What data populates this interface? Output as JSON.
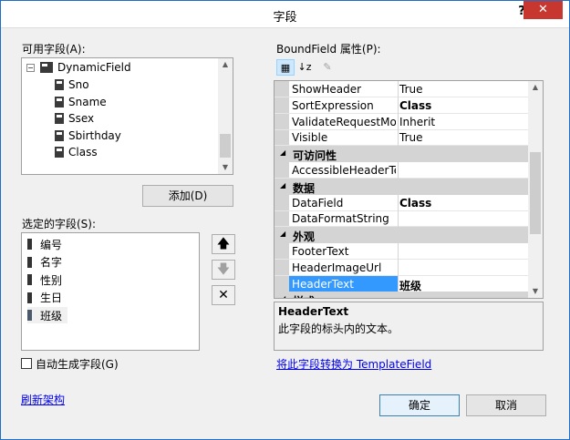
{
  "dialog": {
    "title": "字段",
    "help": "?",
    "close": "✕"
  },
  "available": {
    "label": "可用字段(A):",
    "root": "DynamicField",
    "fields": [
      "Sno",
      "Sname",
      "Ssex",
      "Sbirthday",
      "Class"
    ]
  },
  "add_button": "添加(D)",
  "selected": {
    "label": "选定的字段(S):",
    "items": [
      "编号",
      "名字",
      "性别",
      "生日",
      "班级"
    ]
  },
  "move_up": "🡅",
  "move_down": "🡇",
  "delete": "✕",
  "auto_generate": "自动生成字段(G)",
  "refresh_link": "刷新架构",
  "props": {
    "label": "BoundField 属性(P):",
    "rows": [
      {
        "kind": "prop",
        "name": "ShowHeader",
        "value": "True",
        "bold": false
      },
      {
        "kind": "prop",
        "name": "SortExpression",
        "value": "Class",
        "bold": true
      },
      {
        "kind": "prop",
        "name": "ValidateRequestMode",
        "value": "Inherit",
        "bold": false
      },
      {
        "kind": "prop",
        "name": "Visible",
        "value": "True",
        "bold": false
      },
      {
        "kind": "cat",
        "name": "可访问性"
      },
      {
        "kind": "prop",
        "name": "AccessibleHeaderText",
        "value": "",
        "bold": false
      },
      {
        "kind": "cat",
        "name": "数据"
      },
      {
        "kind": "prop",
        "name": "DataField",
        "value": "Class",
        "bold": true
      },
      {
        "kind": "prop",
        "name": "DataFormatString",
        "value": "",
        "bold": false
      },
      {
        "kind": "cat",
        "name": "外观"
      },
      {
        "kind": "prop",
        "name": "FooterText",
        "value": "",
        "bold": false
      },
      {
        "kind": "prop",
        "name": "HeaderImageUrl",
        "value": "",
        "bold": false
      },
      {
        "kind": "prop",
        "name": "HeaderText",
        "value": "班级",
        "bold": true,
        "selected": true
      },
      {
        "kind": "cat",
        "name": "样式"
      }
    ],
    "desc_title": "HeaderText",
    "desc_text": "此字段的标头内的文本。"
  },
  "convert_link": "将此字段转换为 TemplateField",
  "ok": "确定",
  "cancel": "取消",
  "colors": {
    "selection": "#3399ff",
    "link": "#0000ee",
    "close": "#c7372f"
  }
}
